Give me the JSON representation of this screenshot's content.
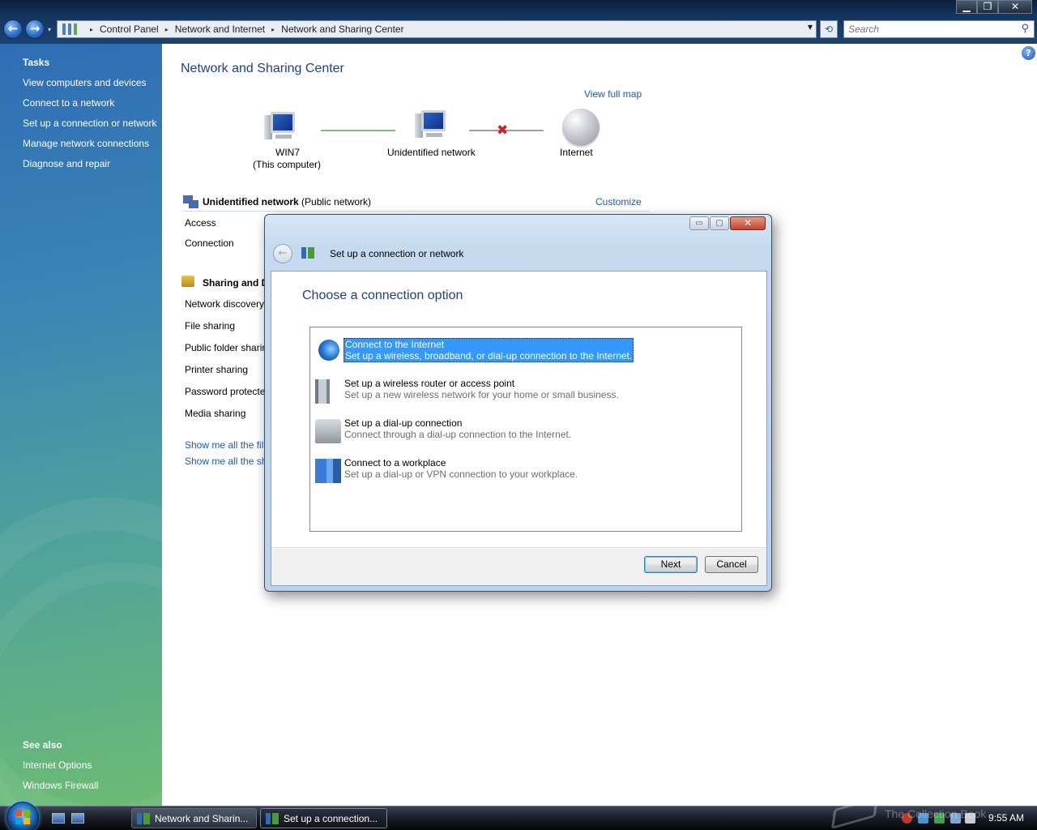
{
  "window": {
    "controls": {
      "minimize": "▁",
      "maximize": "❐",
      "close": "✕"
    }
  },
  "toolbar": {
    "back": "←",
    "forward": "→",
    "nav_drop": "▾",
    "breadcrumbs": [
      "Control Panel",
      "Network and Internet",
      "Network and Sharing Center"
    ],
    "crumb_sep": "▸",
    "address_drop": "▼",
    "refresh": "⟲",
    "search_placeholder": "Search",
    "search_icon": "⚲"
  },
  "sidebar": {
    "tasks_heading": "Tasks",
    "tasks": [
      "View computers and devices",
      "Connect to a network",
      "Set up a connection or network",
      "Manage network connections",
      "Diagnose and repair"
    ],
    "see_also_heading": "See also",
    "see_also": [
      "Internet Options",
      "Windows Firewall"
    ]
  },
  "main": {
    "help": "?",
    "title": "Network and Sharing Center",
    "view_full_map": "View full map",
    "map": {
      "computer_name": "WIN7",
      "computer_sub": "(This computer)",
      "network_name": "Unidentified network",
      "internet": "Internet",
      "broken_link_icon": "✖"
    },
    "network": {
      "name": "Unidentified network",
      "type": "(Public network)",
      "customize": "Customize",
      "rows": [
        {
          "label": "Access"
        },
        {
          "label": "Connection"
        }
      ]
    },
    "sharing": {
      "heading": "Sharing and D",
      "items": [
        "Network discovery",
        "File sharing",
        "Public folder sharir",
        "Printer sharing",
        "Password protecte",
        "Media sharing"
      ],
      "links": [
        "Show me all the fil",
        "Show me all the sh"
      ]
    }
  },
  "dialog": {
    "controls": {
      "minimize": "▭",
      "maximize": "▢",
      "close": "✕"
    },
    "back": "←",
    "title": "Set up a connection or network",
    "heading": "Choose a connection option",
    "options": [
      {
        "title": "Connect to the Internet",
        "desc": "Set up a wireless, broadband, or dial-up connection to the Internet.",
        "icon": "globe-network-icon",
        "selected": true
      },
      {
        "title": "Set up a wireless router or access point",
        "desc": "Set up a new wireless network for your home or small business.",
        "icon": "wireless-router-icon",
        "selected": false
      },
      {
        "title": "Set up a dial-up connection",
        "desc": "Connect through a dial-up connection to the Internet.",
        "icon": "dialup-phone-icon",
        "selected": false
      },
      {
        "title": "Connect to a workplace",
        "desc": "Set up a dial-up or VPN connection to your workplace.",
        "icon": "workplace-building-icon",
        "selected": false
      }
    ],
    "next": "Next",
    "cancel": "Cancel"
  },
  "taskbar": {
    "windows": [
      {
        "label": "Network and Sharin...",
        "active": false
      },
      {
        "label": "Set up a connection...",
        "active": true
      }
    ],
    "clock": "9:55 AM",
    "watermark": "The Collection Book"
  },
  "colors": {
    "link": "#1a5bb5",
    "title": "#1e3f8a",
    "selection": "#3399ff"
  }
}
